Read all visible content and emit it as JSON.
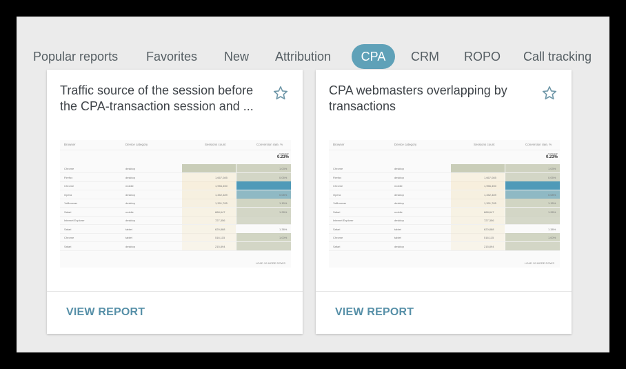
{
  "tabs": [
    {
      "label": "Popular reports",
      "active": false
    },
    {
      "label": "Favorites",
      "active": false
    },
    {
      "label": "New",
      "active": false
    },
    {
      "label": "Attribution",
      "active": false
    },
    {
      "label": "CPA",
      "active": true
    },
    {
      "label": "CRM",
      "active": false
    },
    {
      "label": "ROPO",
      "active": false
    },
    {
      "label": "Call tracking",
      "active": false
    }
  ],
  "colors": {
    "accent": "#5fa1b8",
    "link": "#5790a8"
  },
  "cards": [
    {
      "title": "Traffic source of the session before the CPA-transaction session and ...",
      "action": "VIEW REPORT",
      "icon": "star-outline"
    },
    {
      "title": "CPA webmasters overlapping by transactions",
      "action": "VIEW REPORT",
      "icon": "star-outline"
    }
  ],
  "preview_table": {
    "headers": [
      "Browser",
      "Device category",
      "Sessions count",
      "Conversion rate, %"
    ],
    "average_label": "average",
    "average_value": "0.23%",
    "rows": [
      {
        "browser": "Chrome",
        "device": "desktop",
        "sessions": "",
        "rate": "1.03%",
        "sess_level": 0.5,
        "rate_level": 0.7
      },
      {
        "browser": "Firefox",
        "device": "desktop",
        "sessions": "1,667,085",
        "rate": "0.05%",
        "sess_level": 0.4,
        "rate_level": 0.5
      },
      {
        "browser": "Chrome",
        "device": "mobile",
        "sessions": "1,956,450",
        "rate": "",
        "sess_level": 0.6,
        "rate_level": 1.0
      },
      {
        "browser": "Opera",
        "device": "desktop",
        "sessions": "1,452,489",
        "rate": "0.08%",
        "sess_level": 0.5,
        "rate_level": 0.8
      },
      {
        "browser": "YaBrowser",
        "device": "desktop",
        "sessions": "1,391,785",
        "rate": "1.15%",
        "sess_level": 0.45,
        "rate_level": 0.6
      },
      {
        "browser": "Safari",
        "device": "mobile",
        "sessions": "868,647",
        "rate": "1.28%",
        "sess_level": 0.35,
        "rate_level": 0.5
      },
      {
        "browser": "Internet Explorer",
        "device": "desktop",
        "sessions": "727,356",
        "rate": "",
        "sess_level": 0.3,
        "rate_level": 0.4
      },
      {
        "browser": "Safari",
        "device": "tablet",
        "sessions": "620,888",
        "rate": "1.38%",
        "sess_level": 0.25,
        "rate_level": 0.0
      },
      {
        "browser": "Chrome",
        "device": "tablet",
        "sessions": "516,115",
        "rate": "1.00%",
        "sess_level": 0.2,
        "rate_level": 0.6
      },
      {
        "browser": "Safari",
        "device": "desktop",
        "sessions": "215,894",
        "rate": "",
        "sess_level": 0.15,
        "rate_level": 0.5
      }
    ],
    "load_more": "LOAD 10 MORE ROWS"
  }
}
